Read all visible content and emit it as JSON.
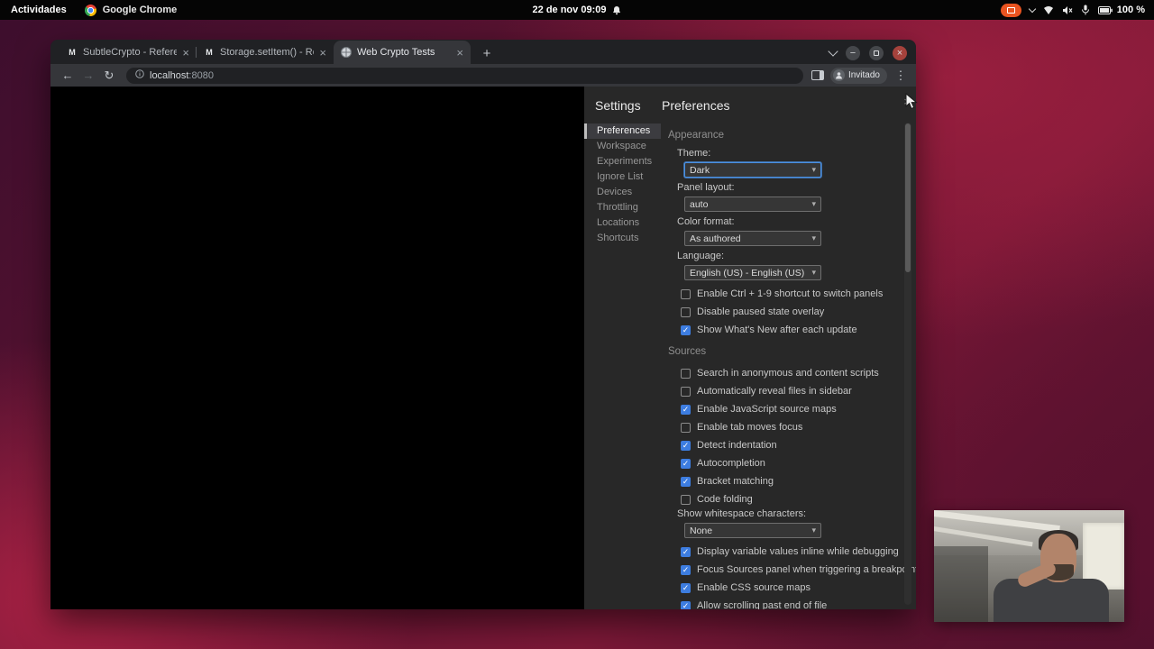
{
  "topbar": {
    "activities_label": "Actividades",
    "app_name": "Google Chrome",
    "clock": "22 de nov 09:09",
    "battery_percent": "100 %"
  },
  "glyphs": {
    "minimize": "−",
    "close": "×",
    "new_tab": "+",
    "back": "←",
    "forward": "→",
    "reload": "↻",
    "menu": "⋮",
    "tab_close": "×",
    "select_arrow": "▾",
    "settings_close": "×"
  },
  "browser": {
    "tabs": [
      {
        "title": "SubtleCrypto - Referenci",
        "icon": "mdn-docs-icon",
        "active": false
      },
      {
        "title": "Storage.setItem() - Refer",
        "icon": "mdn-docs-icon",
        "active": false
      },
      {
        "title": "Web Crypto Tests",
        "icon": "globe-icon",
        "active": true
      }
    ],
    "toolbar": {
      "url_host": "localhost",
      "url_port": ":8080",
      "profile_label": "Invitado"
    }
  },
  "devtools": {
    "settings_title": "Settings",
    "panel_title": "Preferences",
    "sidebar_items": [
      {
        "label": "Preferences",
        "selected": true
      },
      {
        "label": "Workspace"
      },
      {
        "label": "Experiments"
      },
      {
        "label": "Ignore List"
      },
      {
        "label": "Devices"
      },
      {
        "label": "Throttling"
      },
      {
        "label": "Locations"
      },
      {
        "label": "Shortcuts"
      }
    ],
    "sections": [
      {
        "name": "Appearance",
        "controls": [
          {
            "type": "select",
            "label": "Theme:",
            "value": "Dark",
            "focused": true
          },
          {
            "type": "select",
            "label": "Panel layout:",
            "value": "auto"
          },
          {
            "type": "select",
            "label": "Color format:",
            "value": "As authored"
          },
          {
            "type": "select",
            "label": "Language:",
            "value": "English (US) - English (US)"
          },
          {
            "type": "checkbox",
            "label": "Enable Ctrl + 1-9 shortcut to switch panels",
            "checked": false
          },
          {
            "type": "checkbox",
            "label": "Disable paused state overlay",
            "checked": false
          },
          {
            "type": "checkbox",
            "label": "Show What's New after each update",
            "checked": true
          }
        ]
      },
      {
        "name": "Sources",
        "controls": [
          {
            "type": "checkbox",
            "label": "Search in anonymous and content scripts",
            "checked": false
          },
          {
            "type": "checkbox",
            "label": "Automatically reveal files in sidebar",
            "checked": false
          },
          {
            "type": "checkbox",
            "label": "Enable JavaScript source maps",
            "checked": true
          },
          {
            "type": "checkbox",
            "label": "Enable tab moves focus",
            "checked": false
          },
          {
            "type": "checkbox",
            "label": "Detect indentation",
            "checked": true
          },
          {
            "type": "checkbox",
            "label": "Autocompletion",
            "checked": true
          },
          {
            "type": "checkbox",
            "label": "Bracket matching",
            "checked": true
          },
          {
            "type": "checkbox",
            "label": "Code folding",
            "checked": false
          },
          {
            "type": "select",
            "label": "Show whitespace characters:",
            "value": "None"
          },
          {
            "type": "checkbox",
            "label": "Display variable values inline while debugging",
            "checked": true
          },
          {
            "type": "checkbox",
            "label": "Focus Sources panel when triggering a breakpoint",
            "checked": true
          },
          {
            "type": "checkbox",
            "label": "Enable CSS source maps",
            "checked": true
          },
          {
            "type": "checkbox",
            "label": "Allow scrolling past end of file",
            "checked": true
          }
        ]
      }
    ]
  },
  "colors": {
    "accent_blue": "#4a90e2",
    "checkbox_blue": "#3d7de0",
    "indicator_orange": "#E95420",
    "close_button_red": "#a5423c",
    "devtools_bg": "#282828",
    "chrome_toolbar": "#35363a"
  }
}
